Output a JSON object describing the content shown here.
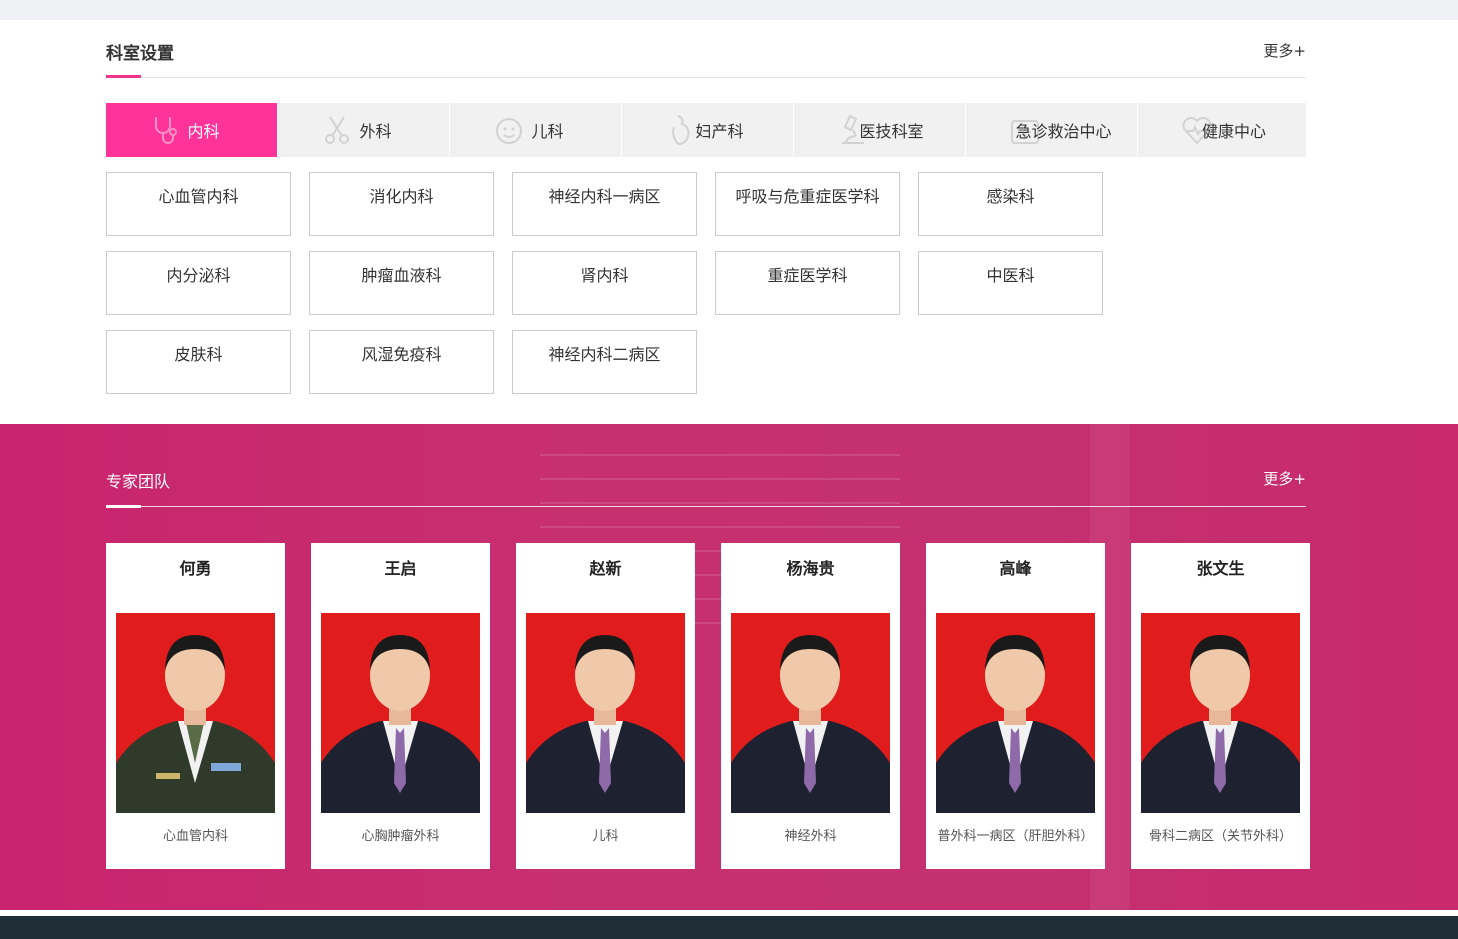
{
  "dept_section": {
    "title": "科室设置",
    "more": "更多+",
    "tabs": [
      {
        "label": "内科",
        "icon": "stethoscope-icon",
        "active": true
      },
      {
        "label": "外科",
        "icon": "scissors-icon",
        "active": false
      },
      {
        "label": "儿科",
        "icon": "child-face-icon",
        "active": false
      },
      {
        "label": "妇产科",
        "icon": "pregnant-icon",
        "active": false
      },
      {
        "label": "医技科室",
        "icon": "microscope-icon",
        "active": false
      },
      {
        "label": "急诊救治中心",
        "icon": "medical-cross-icon",
        "active": false
      },
      {
        "label": "健康中心",
        "icon": "heartbeat-icon",
        "active": false
      }
    ],
    "departments": [
      "心血管内科",
      "消化内科",
      "神经内科一病区",
      "呼吸与危重症医学科",
      "感染科",
      "内分泌科",
      "肿瘤血液科",
      "肾内科",
      "重症医学科",
      "中医科",
      "皮肤科",
      "风湿免疫科",
      "神经内科二病区"
    ]
  },
  "team_section": {
    "title": "专家团队",
    "more": "更多+",
    "experts": [
      {
        "name": "何勇",
        "dept": "心血管内科",
        "uniform": "military"
      },
      {
        "name": "王启",
        "dept": "心胸肿瘤外科",
        "uniform": "suit"
      },
      {
        "name": "赵新",
        "dept": "儿科",
        "uniform": "suit"
      },
      {
        "name": "杨海贵",
        "dept": "神经外科",
        "uniform": "suit"
      },
      {
        "name": "高峰",
        "dept": "普外科一病区（肝胆外科）",
        "uniform": "suit"
      },
      {
        "name": "张文生",
        "dept": "骨科二病区（关节外科）",
        "uniform": "suit"
      }
    ]
  },
  "colors": {
    "accent": "#ff3399",
    "team_bg": "#c7306f",
    "photo_bg": "#e01c1c",
    "footer": "#1f2d36"
  }
}
